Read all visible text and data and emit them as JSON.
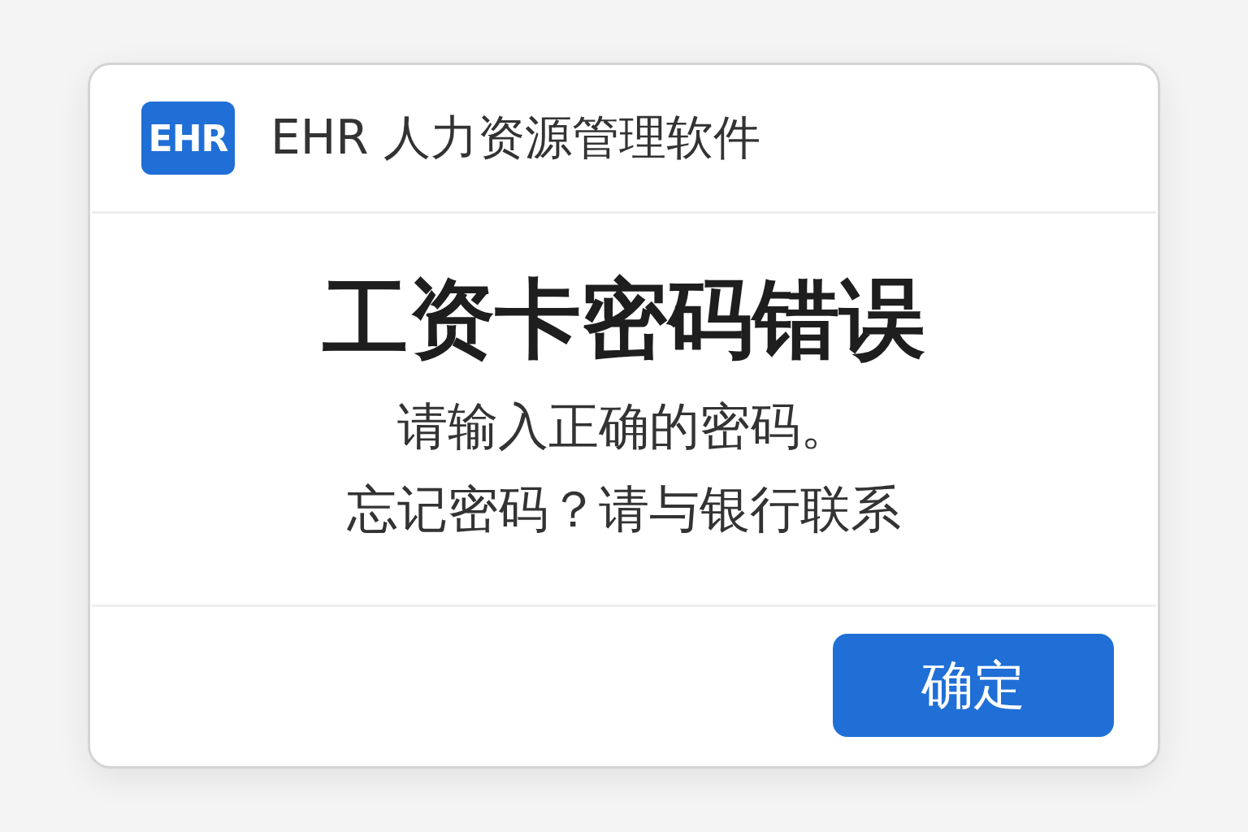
{
  "window": {
    "logo": "EHR",
    "title": "EHR 人力资源管理软件"
  },
  "message": {
    "heading": "工资卡密码错误",
    "lines": [
      "请输入正确的密码。",
      "忘记密码？请与银行联系"
    ]
  },
  "buttons": [
    {
      "label": "确定",
      "kind": "primary"
    }
  ]
}
